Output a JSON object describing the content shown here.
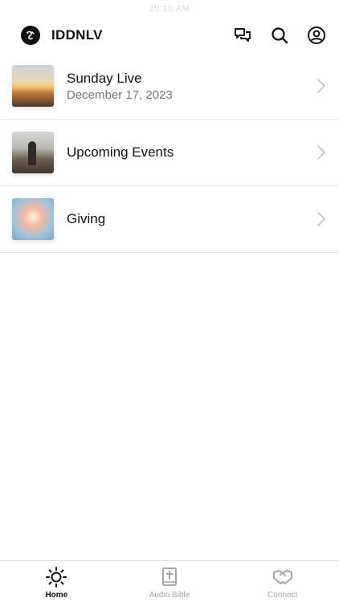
{
  "status_bar": {
    "time": "10:10 AM"
  },
  "header": {
    "app_title": "IDDNLV"
  },
  "list": {
    "items": [
      {
        "title": "Sunday Live",
        "subtitle": "December 17, 2023",
        "thumbnail": "sunset-image"
      },
      {
        "title": "Upcoming Events",
        "subtitle": "",
        "thumbnail": "person-on-hill-image"
      },
      {
        "title": "Giving",
        "subtitle": "",
        "thumbnail": "hands-with-light-image"
      }
    ]
  },
  "tab_bar": {
    "tabs": [
      {
        "label": "Home",
        "icon": "sun-icon",
        "active": true
      },
      {
        "label": "Audio Bible",
        "icon": "bible-icon",
        "active": false
      },
      {
        "label": "Connect",
        "icon": "handshake-icon",
        "active": false
      }
    ]
  },
  "colors": {
    "text": "#111111",
    "muted": "#777777",
    "inactive_tab": "#a6a6a6",
    "divider": "#e8e8e8"
  }
}
